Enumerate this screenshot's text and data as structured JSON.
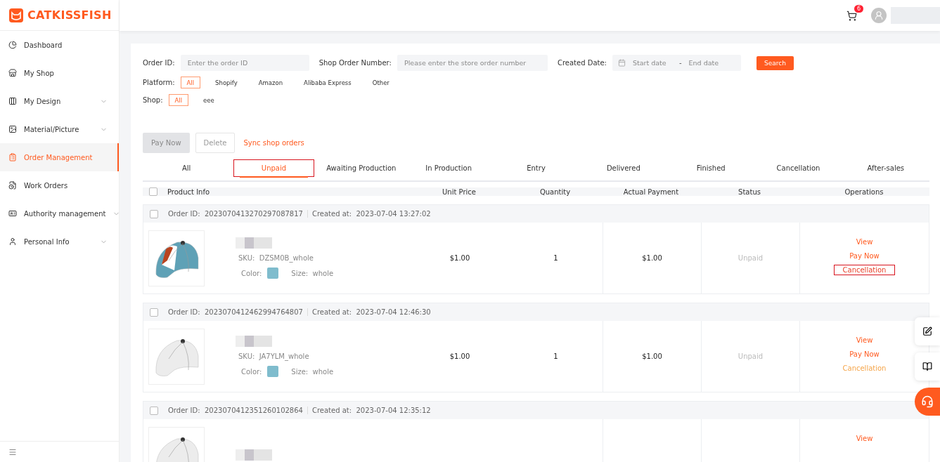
{
  "brand": {
    "name": "CATKISSFISH"
  },
  "sidebar": {
    "items": [
      {
        "label": "Dashboard",
        "expandable": false,
        "selected": false
      },
      {
        "label": "My Shop",
        "expandable": false,
        "selected": false
      },
      {
        "label": "My Design",
        "expandable": true,
        "selected": false
      },
      {
        "label": "Material/Picture",
        "expandable": true,
        "selected": false
      },
      {
        "label": "Order Management",
        "expandable": false,
        "selected": true
      },
      {
        "label": "Work Orders",
        "expandable": false,
        "selected": false
      },
      {
        "label": "Authority management",
        "expandable": true,
        "selected": false
      },
      {
        "label": "Personal Info",
        "expandable": true,
        "selected": false
      }
    ]
  },
  "header": {
    "cart_count": "6"
  },
  "filters": {
    "order_id": {
      "label": "Order ID:",
      "placeholder": "Enter the order ID"
    },
    "shop_order": {
      "label": "Shop Order Number:",
      "placeholder": "Please enter the store order number"
    },
    "created_date": {
      "label": "Created Date:",
      "start_placeholder": "Start date",
      "separator": "-",
      "end_placeholder": "End date"
    },
    "search_button": "Search",
    "platform": {
      "label": "Platform:",
      "options": [
        {
          "label": "All",
          "selected": true
        },
        {
          "label": "Shopify",
          "selected": false
        },
        {
          "label": "Amazon",
          "selected": false
        },
        {
          "label": "Alibaba Express",
          "selected": false
        },
        {
          "label": "Other",
          "selected": false
        }
      ]
    },
    "shop": {
      "label": "Shop:",
      "options": [
        {
          "label": "All",
          "selected": true
        },
        {
          "label": "eee",
          "selected": false
        }
      ]
    }
  },
  "actions": {
    "pay_now": {
      "label": "Pay Now",
      "disabled": true
    },
    "delete": {
      "label": "Delete",
      "disabled": true
    },
    "sync": "Sync shop orders"
  },
  "tabs": [
    {
      "label": "All",
      "selected": false,
      "highlighted": false
    },
    {
      "label": "Unpaid",
      "selected": true,
      "highlighted": true
    },
    {
      "label": "Awaiting Production",
      "selected": false,
      "highlighted": false
    },
    {
      "label": "In Production",
      "selected": false,
      "highlighted": false
    },
    {
      "label": "Entry",
      "selected": false,
      "highlighted": false
    },
    {
      "label": "Delivered",
      "selected": false,
      "highlighted": false
    },
    {
      "label": "Finished",
      "selected": false,
      "highlighted": false
    },
    {
      "label": "Cancellation",
      "selected": false,
      "highlighted": false
    },
    {
      "label": "After-sales",
      "selected": false,
      "highlighted": false
    }
  ],
  "table": {
    "select_all_checked": false,
    "columns": [
      "Product Info",
      "Unit Price",
      "Quantity",
      "Actual Payment",
      "Status",
      "Operations"
    ],
    "orders": [
      {
        "checked": false,
        "order_id_label": "Order ID:",
        "order_id": "20230704132702970878​17",
        "created_label": "Created at:",
        "created_at": "2023-07-04 13:27:02",
        "product": {
          "sku_label": "SKU:",
          "sku": "DZSM0B_whole",
          "color_label": "Color:",
          "color": "#7fbccd",
          "size_label": "Size:",
          "size": "whole"
        },
        "unit_price": "$1.00",
        "quantity": "1",
        "payment": "$1.00",
        "status": "Unpaid",
        "operations": [
          {
            "label": "View",
            "kind": "link",
            "highlighted": false
          },
          {
            "label": "Pay Now",
            "kind": "link",
            "highlighted": false
          },
          {
            "label": "Cancellation",
            "kind": "cancel",
            "highlighted": true
          }
        ]
      },
      {
        "checked": false,
        "order_id_label": "Order ID:",
        "order_id": "20230704124629947648​07",
        "created_label": "Created at:",
        "created_at": "2023-07-04 12:46:30",
        "product": {
          "sku_label": "SKU:",
          "sku": "JA7YLM_whole",
          "color_label": "Color:",
          "color": "#7fbccd",
          "size_label": "Size:",
          "size": "whole"
        },
        "unit_price": "$1.00",
        "quantity": "1",
        "payment": "$1.00",
        "status": "Unpaid",
        "operations": [
          {
            "label": "View",
            "kind": "link",
            "highlighted": false
          },
          {
            "label": "Pay Now",
            "kind": "link",
            "highlighted": false
          },
          {
            "label": "Cancellation",
            "kind": "cancel",
            "highlighted": false
          }
        ]
      },
      {
        "checked": false,
        "order_id_label": "Order ID:",
        "order_id": "20230704123512601028​64",
        "created_label": "Created at:",
        "created_at": "2023-07-04 12:35:12",
        "operations": [
          {
            "label": "View",
            "kind": "link",
            "highlighted": false
          }
        ]
      }
    ]
  }
}
